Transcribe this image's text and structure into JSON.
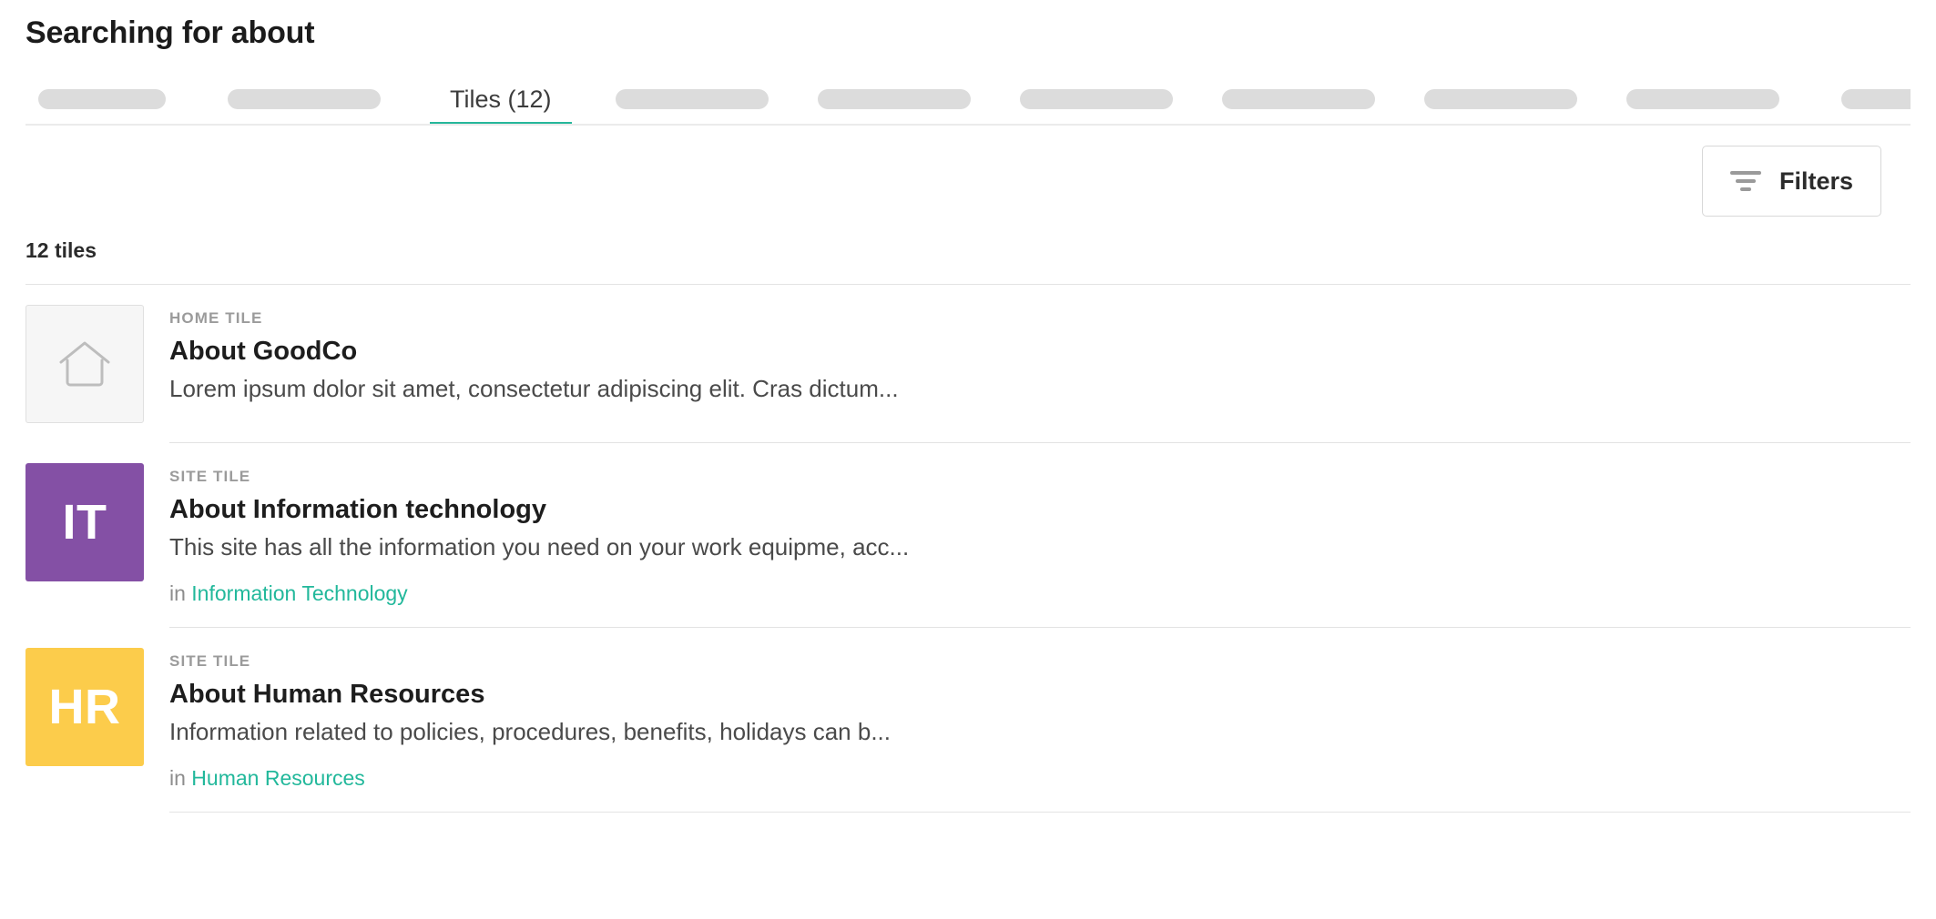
{
  "header": {
    "title": "Searching for about"
  },
  "tabs": {
    "items": [
      {
        "type": "skeleton",
        "width": "short",
        "active": false,
        "label": ""
      },
      {
        "type": "skeleton",
        "width": "wide",
        "active": false,
        "label": ""
      },
      {
        "type": "label",
        "width": "auto",
        "active": true,
        "label": "Tiles (12)"
      },
      {
        "type": "skeleton",
        "width": "wide",
        "active": false,
        "label": ""
      },
      {
        "type": "skeleton",
        "width": "wide",
        "active": false,
        "label": ""
      },
      {
        "type": "skeleton",
        "width": "wide",
        "active": false,
        "label": ""
      },
      {
        "type": "skeleton",
        "width": "wide",
        "active": false,
        "label": ""
      },
      {
        "type": "skeleton",
        "width": "wide",
        "active": false,
        "label": ""
      },
      {
        "type": "skeleton",
        "width": "wide",
        "active": false,
        "label": ""
      },
      {
        "type": "skeleton",
        "width": "short",
        "active": false,
        "label": ""
      },
      {
        "type": "skeleton",
        "width": "short",
        "active": false,
        "label": ""
      }
    ]
  },
  "toolbar": {
    "filters_label": "Filters",
    "filters_icon": "filter-icon"
  },
  "results": {
    "count_label": "12 tiles",
    "context_prefix": "in",
    "items": [
      {
        "kicker": "HOME TILE",
        "title": "About GoodCo",
        "description": "Lorem ipsum dolor sit amet, consectetur adipiscing elit. Cras dictum...",
        "context": "",
        "thumb": {
          "kind": "home-icon",
          "initials": "",
          "color": "#f6f6f6"
        }
      },
      {
        "kicker": "SITE TILE",
        "title": "About Information technology",
        "description": "This site has all the information you need on your work equipme, acc...",
        "context": "Information Technology",
        "thumb": {
          "kind": "initials",
          "initials": "IT",
          "color": "#8450a5"
        }
      },
      {
        "kicker": "SITE TILE",
        "title": "About Human Resources",
        "description": "Information related to policies, procedures, benefits, holidays can b...",
        "context": "Human Resources",
        "thumb": {
          "kind": "initials",
          "initials": "HR",
          "color": "#fccc4b"
        }
      }
    ]
  },
  "colors": {
    "accent": "#22b89b",
    "tab_underline": "#25b79b",
    "skeleton": "#dcdcdc",
    "divider": "#e3e3e3",
    "purple": "#8450a5",
    "yellow": "#fccc4b"
  }
}
